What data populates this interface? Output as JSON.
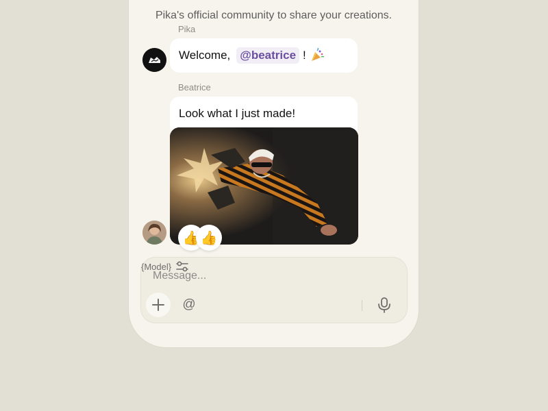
{
  "chat": {
    "intro": "Pika's official community to share your creations.",
    "messages": [
      {
        "sender": "Pika",
        "text_before": "Welcome,",
        "mention": "@beatrice",
        "text_after": "!",
        "emoji": "🎉",
        "avatar": "pika-logo-avatar"
      },
      {
        "sender": "Beatrice",
        "text": "Look what I just made!",
        "media": "video-thumbnail",
        "avatar": "beatrice-avatar",
        "reactions": [
          "👍",
          "👍"
        ]
      }
    ]
  },
  "composer": {
    "placeholder": "Message...",
    "plus_icon": "plus-icon",
    "mention_symbol": "@",
    "model_label": "{Model}",
    "settings_icon": "sliders-icon",
    "mic_icon": "microphone-icon"
  },
  "colors": {
    "background": "#e2dfd4",
    "panel": "#f6f4ec",
    "mention": "#6a4fa0",
    "bubble": "#ffffff"
  }
}
